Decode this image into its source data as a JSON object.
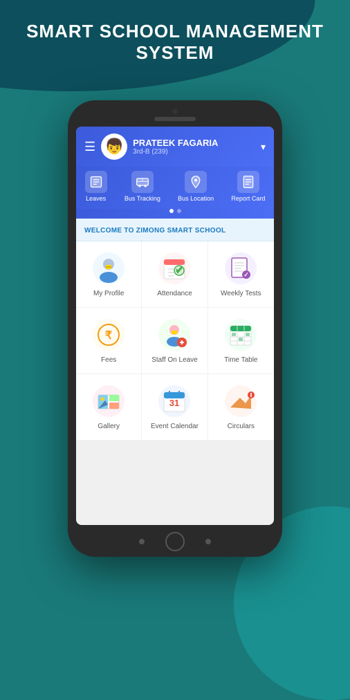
{
  "title": {
    "line1": "SMART SCHOOL MANAGEMENT",
    "line2": "SYSTEM"
  },
  "header": {
    "menu_label": "☰",
    "user_name": "PRATEEK FAGARIA",
    "user_class": "3rd-B (239)",
    "dropdown_arrow": "▾"
  },
  "nav": {
    "items": [
      {
        "id": "leaves",
        "label": "Leaves",
        "icon": "📋"
      },
      {
        "id": "bus-tracking",
        "label": "Bus Tracking",
        "icon": "🚌"
      },
      {
        "id": "bus-location",
        "label": "Bus Location",
        "icon": "📍"
      },
      {
        "id": "report-card",
        "label": "Report Card",
        "icon": "📄"
      }
    ]
  },
  "dots": [
    {
      "active": true
    },
    {
      "active": false
    }
  ],
  "welcome": {
    "text": "WELCOME TO ZIMONG SMART SCHOOL"
  },
  "grid": {
    "items": [
      {
        "id": "my-profile",
        "label": "My Profile",
        "icon": "👨‍💼"
      },
      {
        "id": "attendance",
        "label": "Attendance",
        "icon": "📅"
      },
      {
        "id": "weekly-tests",
        "label": "Weekly Tests",
        "icon": "📝"
      },
      {
        "id": "fees",
        "label": "Fees",
        "icon": "💰"
      },
      {
        "id": "staff-on-leave",
        "label": "Staff On Leave",
        "icon": "👩‍💼"
      },
      {
        "id": "time-table",
        "label": "Time Table",
        "icon": "🗓️"
      },
      {
        "id": "gallery",
        "label": "Gallery",
        "icon": "🖼️"
      },
      {
        "id": "event-calendar",
        "label": "Event Calendar",
        "icon": "📆"
      },
      {
        "id": "circulars",
        "label": "Circulars",
        "icon": "📢"
      }
    ]
  }
}
